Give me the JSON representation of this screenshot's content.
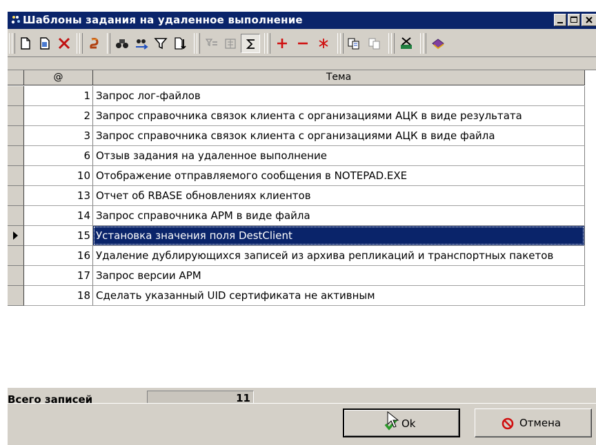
{
  "window": {
    "title": "Шаблоны задания на удаленное выполнение"
  },
  "toolbar": {
    "buttons": [
      "new-doc-icon",
      "copy-doc-icon",
      "delete-icon",
      "refresh-icon",
      "find-icon",
      "find-next-icon",
      "filter-icon",
      "sort-icon",
      "clear-filter-icon",
      "calc-icon",
      "sum-icon",
      "add-icon",
      "remove-icon",
      "asterisk-icon",
      "copy-icon",
      "paste-icon",
      "excel-export-icon",
      "book-icon"
    ]
  },
  "grid": {
    "columns": {
      "num": "@",
      "theme": "Тема"
    },
    "rows": [
      {
        "num": "1",
        "theme": "Запрос лог-файлов"
      },
      {
        "num": "2",
        "theme": "Запрос справочника связок клиента с организациями АЦК в виде результата"
      },
      {
        "num": "3",
        "theme": "Запрос справочника связок клиента с организациями АЦК в виде файла"
      },
      {
        "num": "6",
        "theme": "Отзыв задания на удаленное выполнение"
      },
      {
        "num": "10",
        "theme": "Отображение отправляемого сообщения в NOTEPAD.EXE"
      },
      {
        "num": "13",
        "theme": "Отчет об RBASE обновлениях клиентов"
      },
      {
        "num": "14",
        "theme": "Запрос справочника АРМ в виде файла"
      },
      {
        "num": "15",
        "theme": "Установка значения поля DestClient",
        "selected": true
      },
      {
        "num": "16",
        "theme": "Удаление дублирующихся записей из архива репликаций и транспортных пакетов"
      },
      {
        "num": "17",
        "theme": "Запрос версии АРМ"
      },
      {
        "num": "18",
        "theme": "Сделать указанный UID сертификата не активным"
      }
    ],
    "selection_color": "#0a246a"
  },
  "status": {
    "label": "Всего записей",
    "count": "11"
  },
  "buttons": {
    "ok": "Ok",
    "cancel": "Отмена"
  },
  "colors": {
    "titlebar": "#0a246a",
    "face": "#d4d0c8",
    "ok_check": "#2a9a2a",
    "cancel_icon": "#d01010"
  }
}
